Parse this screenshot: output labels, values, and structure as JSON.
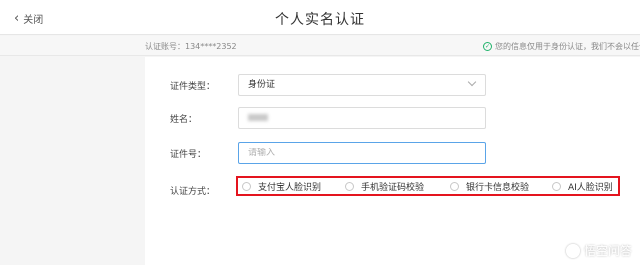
{
  "header": {
    "close_label": "关闭",
    "title": "个人实名认证"
  },
  "info_bar": {
    "account": "认证账号：134****2352",
    "privacy_note": "您的信息仅用于身份认证，我们不会以任何"
  },
  "form": {
    "id_type": {
      "label": "证件类型：",
      "value": "身份证"
    },
    "name": {
      "label": "姓名："
    },
    "id_number": {
      "label": "证件号：",
      "placeholder": "请输入"
    },
    "method": {
      "label": "认证方式：",
      "options": [
        "支付宝人脸识别",
        "手机验证码校验",
        "银行卡信息校验",
        "AI人脸识别"
      ]
    }
  },
  "watermark": {
    "text": "悟空问答"
  },
  "colors": {
    "highlight": "#e4141e",
    "focus": "#5aa4e8",
    "success": "#21b36b"
  }
}
